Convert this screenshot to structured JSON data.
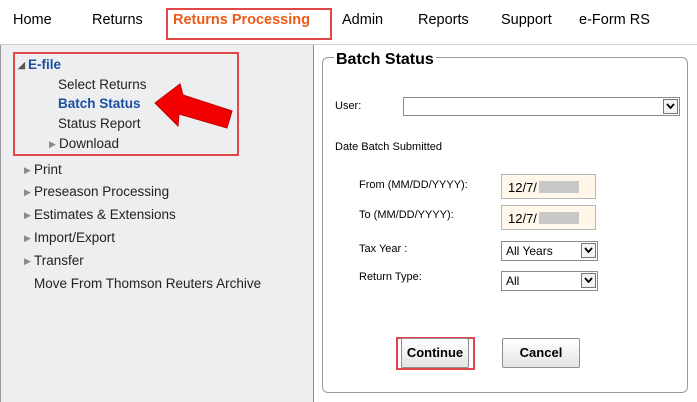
{
  "topnav": {
    "items": [
      "Home",
      "Returns",
      "Returns Processing",
      "Admin",
      "Reports",
      "Support",
      "e-Form RS"
    ],
    "active": "Returns Processing"
  },
  "sidebar": {
    "efile": "E-file",
    "efile_items": [
      "Select Returns",
      "Batch Status",
      "Status Report",
      "Download"
    ],
    "items": [
      "Print",
      "Preseason Processing",
      "Estimates & Extensions",
      "Import/Export",
      "Transfer",
      "Move From Thomson Reuters Archive"
    ]
  },
  "form": {
    "title": "Batch Status",
    "user_label": "User:",
    "user_value": "",
    "date_section": "Date Batch Submitted",
    "from_label": "From (MM/DD/YYYY):",
    "from_value": "12/7/",
    "to_label": "To (MM/DD/YYYY):",
    "to_value": "12/7/",
    "tax_year_label": "Tax Year :",
    "tax_year_value": "All Years",
    "return_type_label": "Return Type:",
    "return_type_value": "All",
    "continue_label": "Continue",
    "cancel_label": "Cancel"
  },
  "colors": {
    "highlight": "#e0464a",
    "active_nav": "#ec5b18",
    "link_blue": "#1a4fa3",
    "arrow": "#f20000"
  }
}
